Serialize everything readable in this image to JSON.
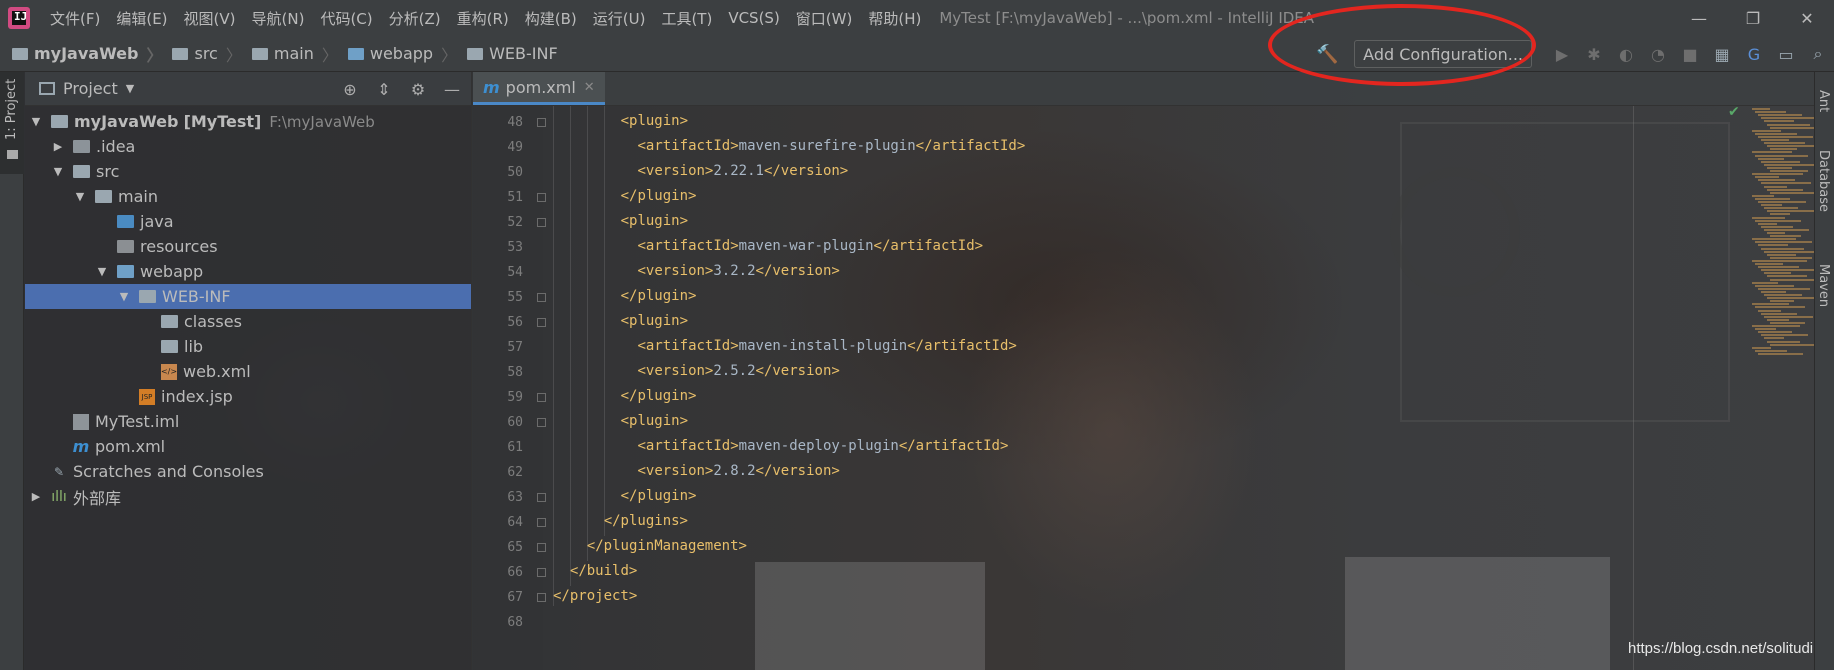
{
  "app": {
    "logo_text": "IJ",
    "window_title": "MyTest [F:\\myJavaWeb] - ...\\pom.xml - IntelliJ IDEA"
  },
  "menu": [
    "文件(F)",
    "编辑(E)",
    "视图(V)",
    "导航(N)",
    "代码(C)",
    "分析(Z)",
    "重构(R)",
    "构建(B)",
    "运行(U)",
    "工具(T)",
    "VCS(S)",
    "窗口(W)",
    "帮助(H)"
  ],
  "window_controls": {
    "minimize": "—",
    "restore": "❐",
    "close": "✕"
  },
  "breadcrumb": [
    "myJavaWeb",
    "src",
    "main",
    "webapp",
    "WEB-INF"
  ],
  "toolbar": {
    "build_icon": "hammer-icon",
    "add_configuration": "Add Configuration...",
    "icons": [
      "run-icon",
      "debug-icon",
      "coverage-icon",
      "profile-icon",
      "stop-icon",
      "project-structure-icon",
      "translate-icon",
      "terminal-icon",
      "search-icon"
    ]
  },
  "left_strip": {
    "project_tab": "1: Project"
  },
  "project_panel": {
    "title": "Project",
    "tools": [
      "locate-icon",
      "collapse-icon",
      "settings-icon",
      "hide-icon"
    ],
    "tree": [
      {
        "label": "myJavaWeb",
        "suffix": "[MyTest]",
        "path": "F:\\myJavaWeb",
        "expanded": true
      },
      {
        "label": ".idea"
      },
      {
        "label": "src"
      },
      {
        "label": "main"
      },
      {
        "label": "java"
      },
      {
        "label": "resources"
      },
      {
        "label": "webapp"
      },
      {
        "label": "WEB-INF",
        "selected": true
      },
      {
        "label": "classes"
      },
      {
        "label": "lib"
      },
      {
        "label": "web.xml"
      },
      {
        "label": "index.jsp"
      },
      {
        "label": "MyTest.iml"
      },
      {
        "label": "pom.xml"
      },
      {
        "label": "Scratches and Consoles"
      },
      {
        "label": "外部库"
      }
    ]
  },
  "editor": {
    "tab": {
      "icon": "m",
      "label": "pom.xml",
      "close": "✕"
    },
    "line_numbers": [
      "48",
      "49",
      "50",
      "51",
      "52",
      "53",
      "54",
      "55",
      "56",
      "57",
      "58",
      "59",
      "60",
      "61",
      "62",
      "63",
      "64",
      "65",
      "66",
      "67",
      "68"
    ],
    "lines": [
      "<plugin>",
      "<artifactId>maven-surefire-plugin</artifactId>",
      "<version>2.22.1</version>",
      "</plugin>",
      "<plugin>",
      "<artifactId>maven-war-plugin</artifactId>",
      "<version>3.2.2</version>",
      "</plugin>",
      "<plugin>",
      "<artifactId>maven-install-plugin</artifactId>",
      "<version>2.5.2</version>",
      "</plugin>",
      "<plugin>",
      "<artifactId>maven-deploy-plugin</artifactId>",
      "<version>2.8.2</version>",
      "</plugin>",
      "</plugins>",
      "</pluginManagement>",
      "</build>",
      "</project>",
      ""
    ]
  },
  "right_strip": [
    "Ant",
    "Database",
    "Maven"
  ],
  "watermark": "https://blog.csdn.net/solitudi",
  "colors": {
    "accent_selection": "#4b6eaf",
    "xml_tag": "#e8bf6a",
    "annotation_circle": "#e3261f",
    "build_green": "#59a869"
  }
}
